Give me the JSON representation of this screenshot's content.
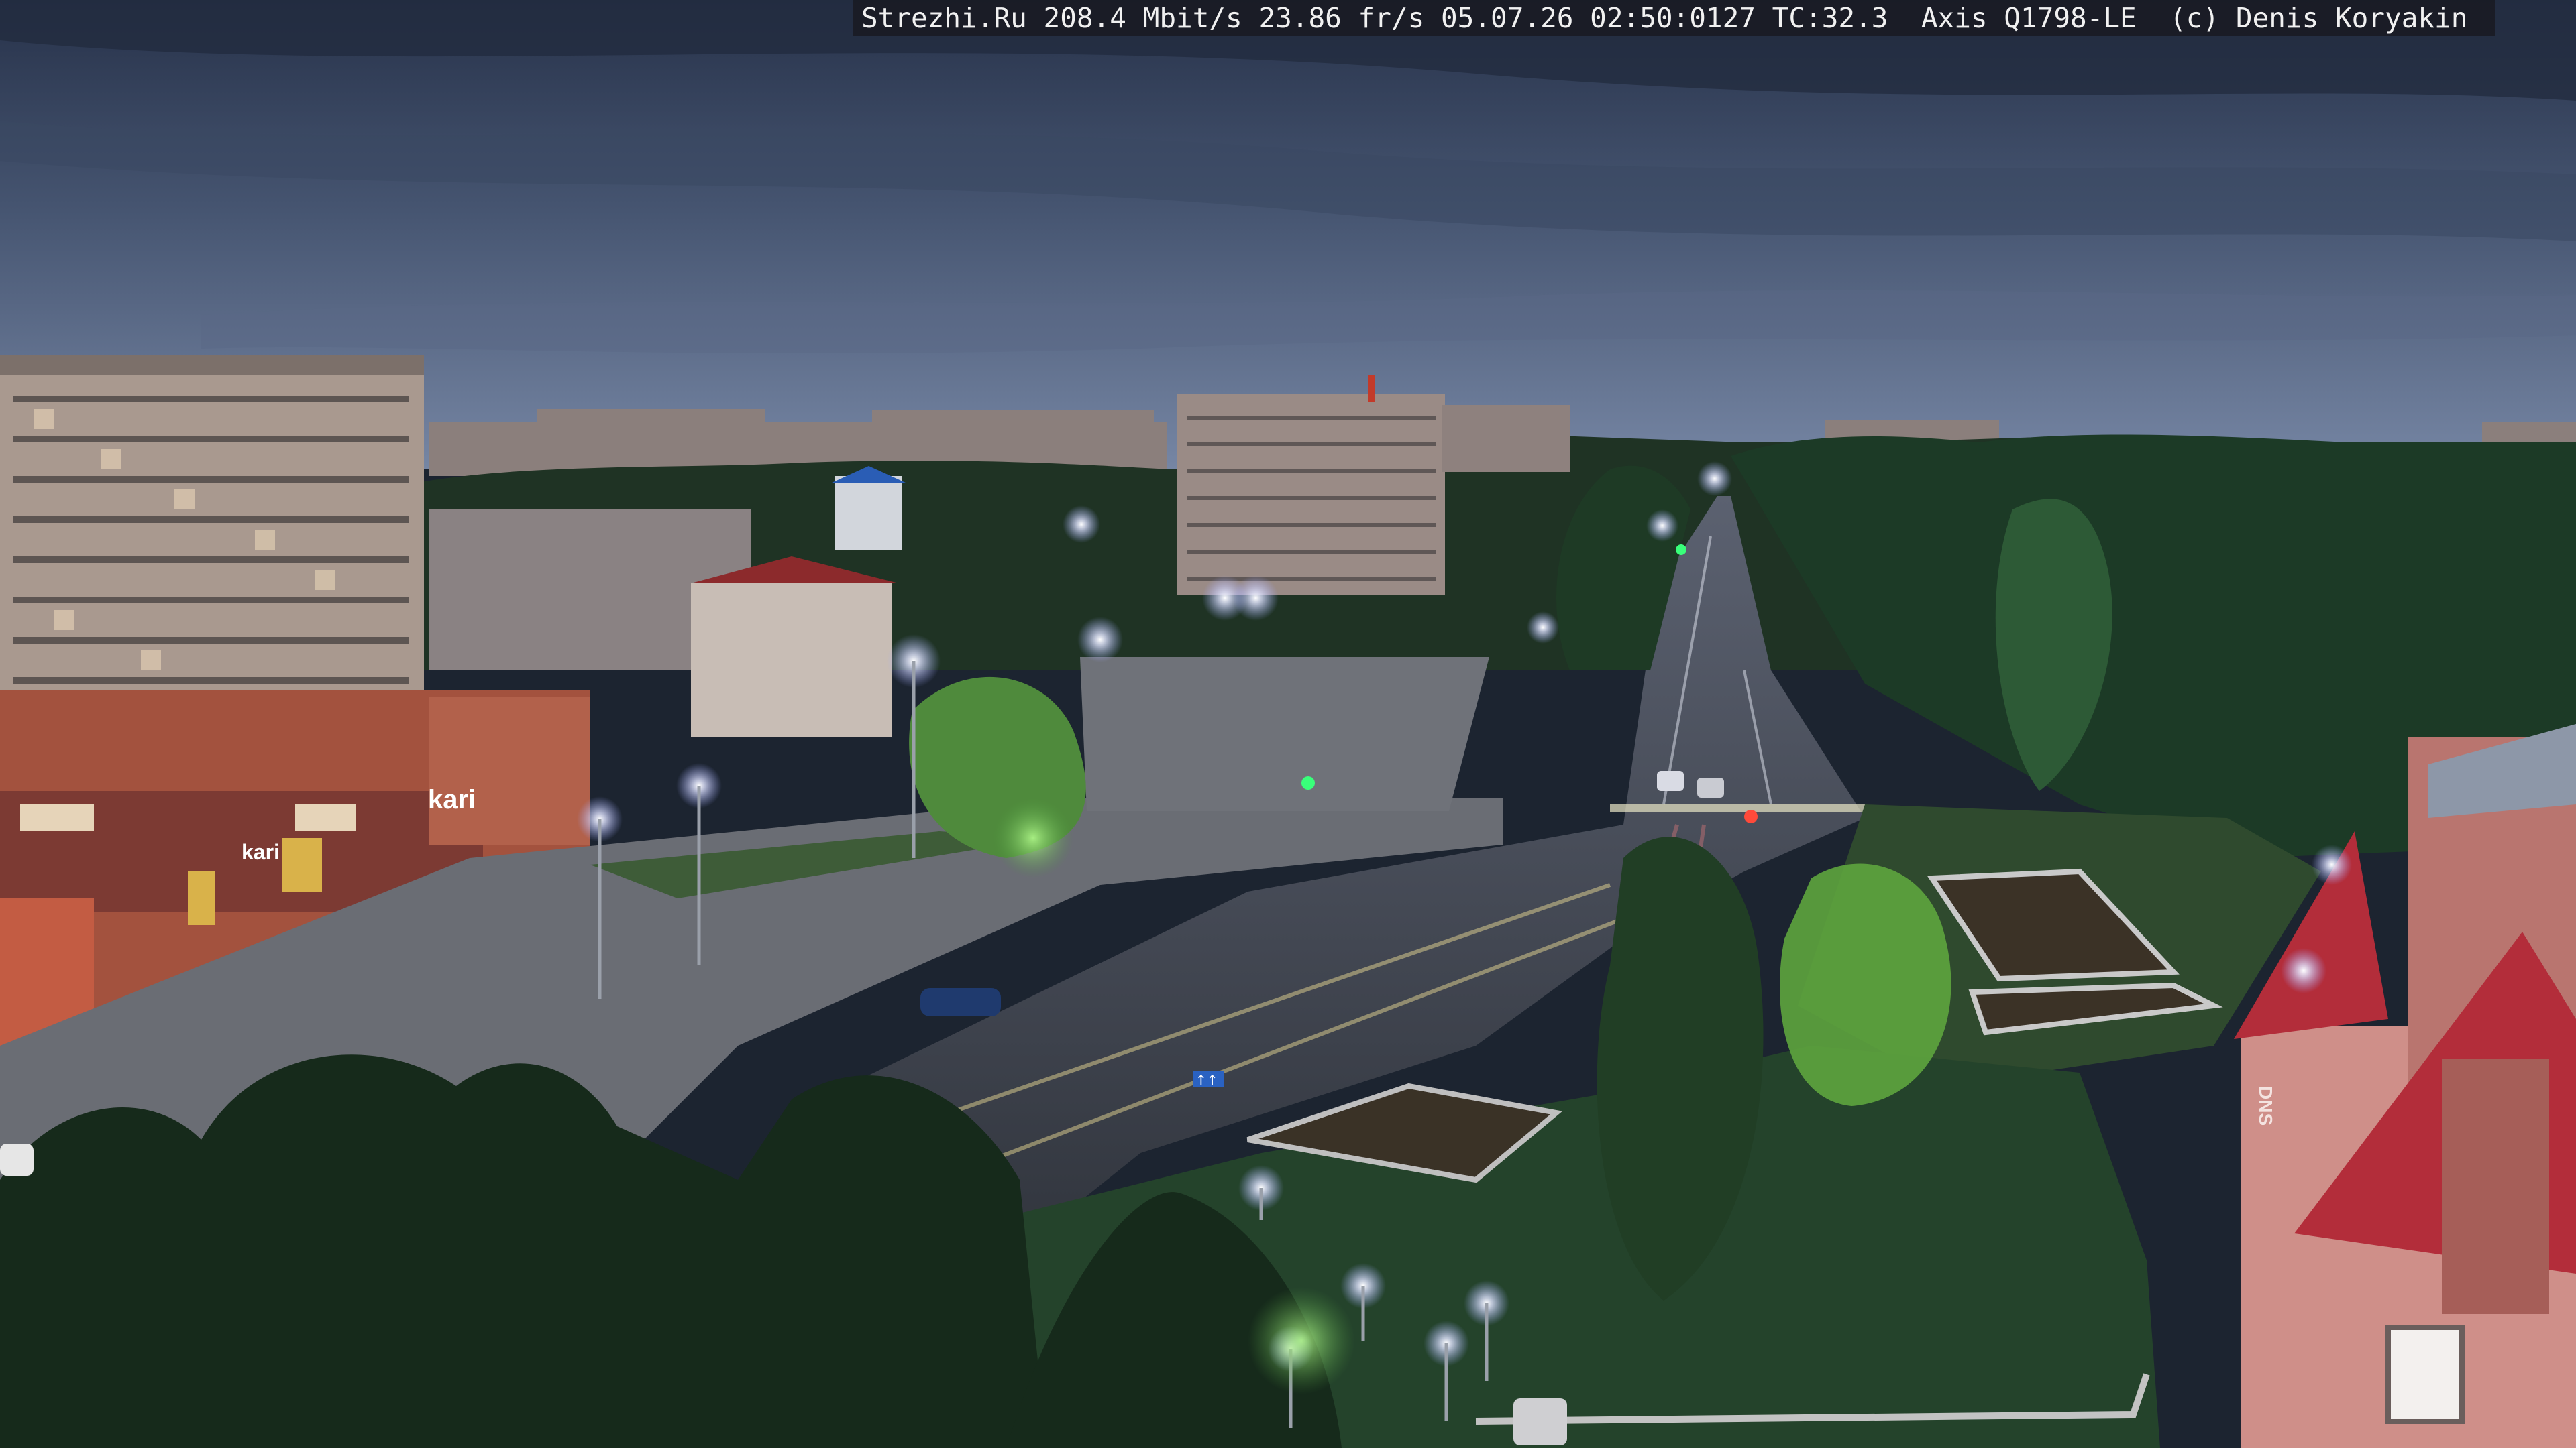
{
  "overlay": {
    "site": "Strezhi.Ru",
    "bitrate": "208.4 Mbit/s",
    "framerate": "23.86 fr/s",
    "date": "05.07.26",
    "time": "02:50:0127",
    "temperature": "TC:32.3",
    "camera": "Axis Q1798-LE",
    "copyright": "(c) Denis Koryakin"
  },
  "storefront": {
    "sign_kari_large": "kari",
    "sign_kari_small": "kari",
    "sign_dns": "DNS"
  },
  "road_signs": {
    "lane_sign": "↑↑"
  },
  "colors": {
    "sky_top": "#2f3b52",
    "sky_horizon": "#6b7a97",
    "street_light": "#e6e9ff",
    "roof_red": "#b32d3a"
  }
}
